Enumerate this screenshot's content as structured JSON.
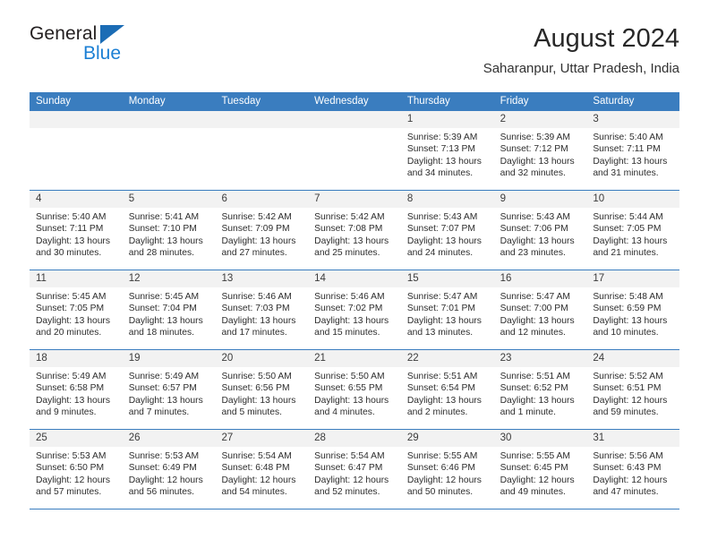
{
  "brand": {
    "name_top": "General",
    "name_bottom": "Blue",
    "accent_dark": "#1b6cb5",
    "accent_light": "#1b7fd4"
  },
  "header": {
    "title": "August 2024",
    "subtitle": "Saharanpur, Uttar Pradesh, India"
  },
  "theme": {
    "header_blue": "#3a7dbf",
    "daynum_band": "#f2f2f2"
  },
  "calendar": {
    "weekday_headers": [
      "Sunday",
      "Monday",
      "Tuesday",
      "Wednesday",
      "Thursday",
      "Friday",
      "Saturday"
    ],
    "weeks": [
      [
        {
          "day": "",
          "sunrise": "",
          "sunset": "",
          "daylight": ""
        },
        {
          "day": "",
          "sunrise": "",
          "sunset": "",
          "daylight": ""
        },
        {
          "day": "",
          "sunrise": "",
          "sunset": "",
          "daylight": ""
        },
        {
          "day": "",
          "sunrise": "",
          "sunset": "",
          "daylight": ""
        },
        {
          "day": "1",
          "sunrise": "Sunrise: 5:39 AM",
          "sunset": "Sunset: 7:13 PM",
          "daylight": "Daylight: 13 hours and 34 minutes."
        },
        {
          "day": "2",
          "sunrise": "Sunrise: 5:39 AM",
          "sunset": "Sunset: 7:12 PM",
          "daylight": "Daylight: 13 hours and 32 minutes."
        },
        {
          "day": "3",
          "sunrise": "Sunrise: 5:40 AM",
          "sunset": "Sunset: 7:11 PM",
          "daylight": "Daylight: 13 hours and 31 minutes."
        }
      ],
      [
        {
          "day": "4",
          "sunrise": "Sunrise: 5:40 AM",
          "sunset": "Sunset: 7:11 PM",
          "daylight": "Daylight: 13 hours and 30 minutes."
        },
        {
          "day": "5",
          "sunrise": "Sunrise: 5:41 AM",
          "sunset": "Sunset: 7:10 PM",
          "daylight": "Daylight: 13 hours and 28 minutes."
        },
        {
          "day": "6",
          "sunrise": "Sunrise: 5:42 AM",
          "sunset": "Sunset: 7:09 PM",
          "daylight": "Daylight: 13 hours and 27 minutes."
        },
        {
          "day": "7",
          "sunrise": "Sunrise: 5:42 AM",
          "sunset": "Sunset: 7:08 PM",
          "daylight": "Daylight: 13 hours and 25 minutes."
        },
        {
          "day": "8",
          "sunrise": "Sunrise: 5:43 AM",
          "sunset": "Sunset: 7:07 PM",
          "daylight": "Daylight: 13 hours and 24 minutes."
        },
        {
          "day": "9",
          "sunrise": "Sunrise: 5:43 AM",
          "sunset": "Sunset: 7:06 PM",
          "daylight": "Daylight: 13 hours and 23 minutes."
        },
        {
          "day": "10",
          "sunrise": "Sunrise: 5:44 AM",
          "sunset": "Sunset: 7:05 PM",
          "daylight": "Daylight: 13 hours and 21 minutes."
        }
      ],
      [
        {
          "day": "11",
          "sunrise": "Sunrise: 5:45 AM",
          "sunset": "Sunset: 7:05 PM",
          "daylight": "Daylight: 13 hours and 20 minutes."
        },
        {
          "day": "12",
          "sunrise": "Sunrise: 5:45 AM",
          "sunset": "Sunset: 7:04 PM",
          "daylight": "Daylight: 13 hours and 18 minutes."
        },
        {
          "day": "13",
          "sunrise": "Sunrise: 5:46 AM",
          "sunset": "Sunset: 7:03 PM",
          "daylight": "Daylight: 13 hours and 17 minutes."
        },
        {
          "day": "14",
          "sunrise": "Sunrise: 5:46 AM",
          "sunset": "Sunset: 7:02 PM",
          "daylight": "Daylight: 13 hours and 15 minutes."
        },
        {
          "day": "15",
          "sunrise": "Sunrise: 5:47 AM",
          "sunset": "Sunset: 7:01 PM",
          "daylight": "Daylight: 13 hours and 13 minutes."
        },
        {
          "day": "16",
          "sunrise": "Sunrise: 5:47 AM",
          "sunset": "Sunset: 7:00 PM",
          "daylight": "Daylight: 13 hours and 12 minutes."
        },
        {
          "day": "17",
          "sunrise": "Sunrise: 5:48 AM",
          "sunset": "Sunset: 6:59 PM",
          "daylight": "Daylight: 13 hours and 10 minutes."
        }
      ],
      [
        {
          "day": "18",
          "sunrise": "Sunrise: 5:49 AM",
          "sunset": "Sunset: 6:58 PM",
          "daylight": "Daylight: 13 hours and 9 minutes."
        },
        {
          "day": "19",
          "sunrise": "Sunrise: 5:49 AM",
          "sunset": "Sunset: 6:57 PM",
          "daylight": "Daylight: 13 hours and 7 minutes."
        },
        {
          "day": "20",
          "sunrise": "Sunrise: 5:50 AM",
          "sunset": "Sunset: 6:56 PM",
          "daylight": "Daylight: 13 hours and 5 minutes."
        },
        {
          "day": "21",
          "sunrise": "Sunrise: 5:50 AM",
          "sunset": "Sunset: 6:55 PM",
          "daylight": "Daylight: 13 hours and 4 minutes."
        },
        {
          "day": "22",
          "sunrise": "Sunrise: 5:51 AM",
          "sunset": "Sunset: 6:54 PM",
          "daylight": "Daylight: 13 hours and 2 minutes."
        },
        {
          "day": "23",
          "sunrise": "Sunrise: 5:51 AM",
          "sunset": "Sunset: 6:52 PM",
          "daylight": "Daylight: 13 hours and 1 minute."
        },
        {
          "day": "24",
          "sunrise": "Sunrise: 5:52 AM",
          "sunset": "Sunset: 6:51 PM",
          "daylight": "Daylight: 12 hours and 59 minutes."
        }
      ],
      [
        {
          "day": "25",
          "sunrise": "Sunrise: 5:53 AM",
          "sunset": "Sunset: 6:50 PM",
          "daylight": "Daylight: 12 hours and 57 minutes."
        },
        {
          "day": "26",
          "sunrise": "Sunrise: 5:53 AM",
          "sunset": "Sunset: 6:49 PM",
          "daylight": "Daylight: 12 hours and 56 minutes."
        },
        {
          "day": "27",
          "sunrise": "Sunrise: 5:54 AM",
          "sunset": "Sunset: 6:48 PM",
          "daylight": "Daylight: 12 hours and 54 minutes."
        },
        {
          "day": "28",
          "sunrise": "Sunrise: 5:54 AM",
          "sunset": "Sunset: 6:47 PM",
          "daylight": "Daylight: 12 hours and 52 minutes."
        },
        {
          "day": "29",
          "sunrise": "Sunrise: 5:55 AM",
          "sunset": "Sunset: 6:46 PM",
          "daylight": "Daylight: 12 hours and 50 minutes."
        },
        {
          "day": "30",
          "sunrise": "Sunrise: 5:55 AM",
          "sunset": "Sunset: 6:45 PM",
          "daylight": "Daylight: 12 hours and 49 minutes."
        },
        {
          "day": "31",
          "sunrise": "Sunrise: 5:56 AM",
          "sunset": "Sunset: 6:43 PM",
          "daylight": "Daylight: 12 hours and 47 minutes."
        }
      ]
    ]
  }
}
